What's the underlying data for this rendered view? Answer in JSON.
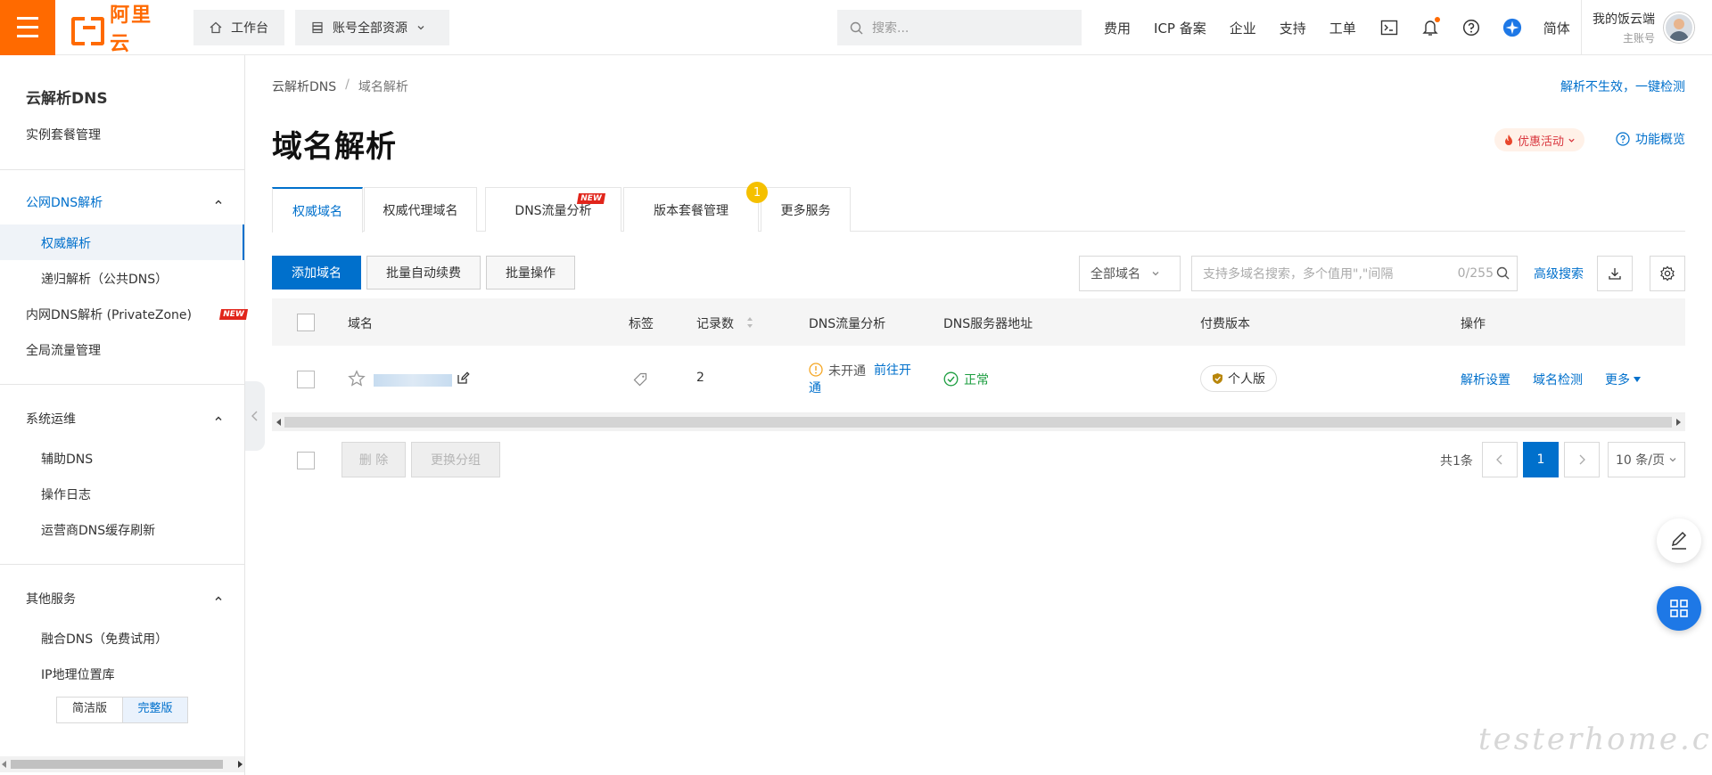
{
  "topbar": {
    "logo_text": "阿里云",
    "workbench": "工作台",
    "resources": "账号全部资源",
    "search_placeholder": "搜索...",
    "links": [
      "费用",
      "ICP 备案",
      "企业",
      "支持",
      "工单"
    ],
    "lang": "简体",
    "user_name": "我的饭云端",
    "user_role": "主账号",
    "brand_color": "#ff6a00"
  },
  "sidebar": {
    "title": "云解析DNS",
    "instance": "实例套餐管理",
    "group_public": "公网DNS解析",
    "auth_resolve": "权威解析",
    "recursive": "递归解析（公共DNS）",
    "private_zone": "内网DNS解析 (PrivateZone)",
    "new_tag": "NEW",
    "global_traffic": "全局流量管理",
    "group_ops": "系统运维",
    "assist_dns": "辅助DNS",
    "op_log": "操作日志",
    "isp_cache": "运营商DNS缓存刷新",
    "group_other": "其他服务",
    "fusion_dns": "融合DNS（免费试用）",
    "ip_geo": "IP地理位置库",
    "ver_simple": "简洁版",
    "ver_full": "完整版"
  },
  "main": {
    "crumb_root": "云解析DNS",
    "crumb_sep": "/",
    "crumb_current": "域名解析",
    "check_link": "解析不生效，一键检测",
    "title": "域名解析",
    "promo": "优惠活动",
    "overview": "功能概览",
    "tabs": [
      "权威域名",
      "权威代理域名",
      "DNS流量分析",
      "版本套餐管理",
      "更多服务"
    ],
    "tab_new": "NEW",
    "tab_badge": "1",
    "btn_add": "添加域名",
    "btn_renew": "批量自动续费",
    "btn_batch": "批量操作",
    "select_all": "全部域名",
    "search_placeholder": "支持多域名搜索，多个值用\",\"间隔",
    "search_count": "0/255",
    "advanced": "高级搜索"
  },
  "table": {
    "headers": {
      "domain": "域名",
      "tag": "标签",
      "records": "记录数",
      "dns_traffic": "DNS流量分析",
      "dns_server": "DNS服务器地址",
      "edition": "付费版本",
      "ops": "操作"
    },
    "rows": [
      {
        "records": "2",
        "traffic_status": "未开通",
        "traffic_link": "前往开通",
        "server_status": "正常",
        "edition": "个人版",
        "op_settings": "解析设置",
        "op_check": "域名检测",
        "op_more": "更多"
      }
    ]
  },
  "footer": {
    "btn_delete": "删 除",
    "btn_regroup": "更换分组",
    "total": "共1条",
    "page": "1",
    "page_size": "10 条/页"
  },
  "watermark": "testerhome.com"
}
